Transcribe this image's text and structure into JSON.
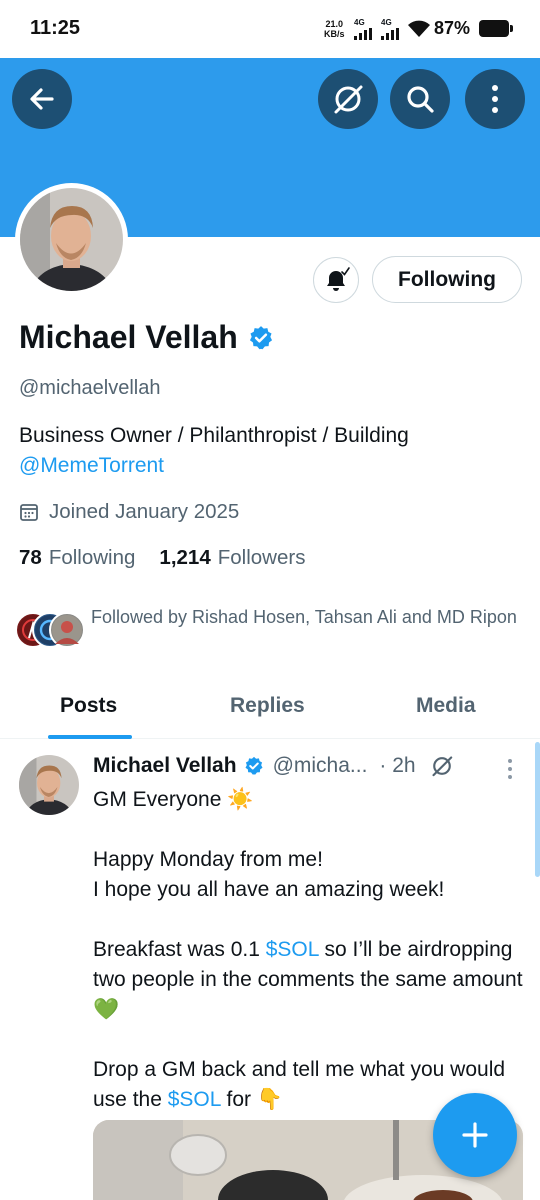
{
  "status_bar": {
    "time": "11:25",
    "net_speed_value": "21.0",
    "net_speed_unit": "KB/s",
    "signal_1_label": "4G",
    "signal_2_label": "4G",
    "battery_percent": "87%"
  },
  "header": {
    "back_icon": "arrow-left-icon",
    "grok_icon": "grok-icon",
    "search_icon": "search-icon",
    "more_icon": "more-vertical-icon",
    "banner_color": "#2d9bec"
  },
  "profile": {
    "name": "Michael Vellah",
    "handle": "@michaelvellah",
    "bio_text": "Business Owner / Philanthropist / Building",
    "bio_link": "@MemeTorrent",
    "joined": "Joined January 2025",
    "following_count": "78",
    "following_label": "Following",
    "followers_count": "1,214",
    "followers_label": "Followers",
    "followed_by": "Followed by Rishad Hosen, Tahsan Ali and MD Ripon",
    "follow_button": "Following",
    "verified": true
  },
  "tabs": [
    {
      "label": "Posts",
      "active": true
    },
    {
      "label": "Replies",
      "active": false
    },
    {
      "label": "Media",
      "active": false
    }
  ],
  "post": {
    "author": "Michael Vellah",
    "handle": "@micha...",
    "time": "· 2h",
    "line1": "GM Everyone ☀️",
    "p2_line1": "Happy Monday from me!",
    "p2_line2": "I hope you all have an amazing week!",
    "p3_before": "Breakfast was 0.1 ",
    "p3_cashtag": "$SOL",
    "p3_after": " so I’ll be airdropping two people in the comments the same amount 💚",
    "p4_before": "Drop a GM back and tell me what you would use the ",
    "p4_cashtag": "$SOL",
    "p4_after": " for 👇"
  },
  "fab": {
    "icon": "plus-icon"
  },
  "colors": {
    "accent": "#1d9bf0",
    "text_primary": "#0f1419",
    "text_secondary": "#536471",
    "header_button": "#1d4f73"
  }
}
